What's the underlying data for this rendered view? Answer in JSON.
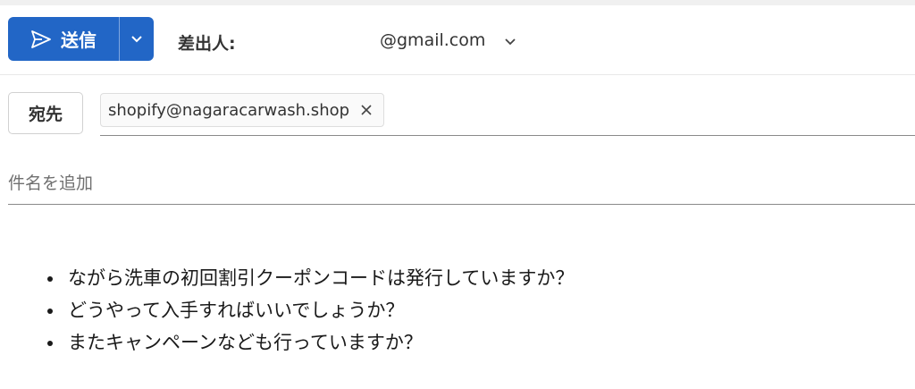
{
  "compose": {
    "send_label": "送信",
    "from_label": "差出人:",
    "from_value": "@gmail.com",
    "to_label": "宛先",
    "recipients": [
      "shopify@nagaracarwash.shop"
    ],
    "subject_placeholder": "件名を追加",
    "subject_value": "",
    "body_items": [
      "ながら洗車の初回割引クーポンコードは発行していますか？",
      "どうやって入手すればいいでしょうか？",
      "またキャンペーンなども行っていますか？"
    ]
  },
  "colors": {
    "send_button": "#2266c6",
    "text": "#242424"
  },
  "icons": {
    "send": "send-icon",
    "dropdown": "chevron-down-icon",
    "remove_recipient": "close-icon"
  }
}
